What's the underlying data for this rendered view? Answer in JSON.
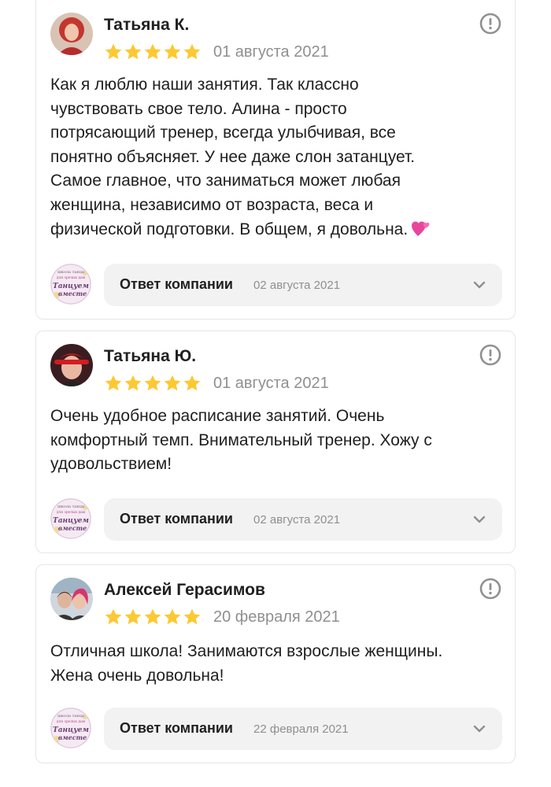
{
  "reviews": [
    {
      "author": "Татьяна К.",
      "rating": 5,
      "date": "01 августа 2021",
      "text_lines": [
        "Как я люблю наши занятия. Так классно",
        "чувствовать свое тело. Алина - просто",
        "потрясающий тренер, всегда улыбчивая, все",
        "понятно объясняет. У нее даже слон затанцует.",
        "Самое главное, что заниматься может любая",
        "женщина, независимо от возраста, веса и",
        "физической подготовки. В общем, я довольна."
      ],
      "emoji_icon": "two-hearts-icon",
      "reply_label": "Ответ компании",
      "reply_date": "02 августа 2021"
    },
    {
      "author": "Татьяна Ю.",
      "rating": 5,
      "date": "01 августа 2021",
      "text_lines": [
        "Очень удобное расписание занятий. Очень",
        "комфортный темп. Внимательный тренер. Хожу с",
        "удовольствием!"
      ],
      "reply_label": "Ответ компании",
      "reply_date": "02 августа 2021"
    },
    {
      "author": "Алексей Герасимов",
      "rating": 5,
      "date": "20 февраля 2021",
      "text_lines": [
        "Отличная школа! Занимаются взрослые женщины.",
        "Жена очень довольна!"
      ],
      "reply_label": "Ответ компании",
      "reply_date": "22 февраля 2021"
    }
  ],
  "company_logo": {
    "line1": "школа танца",
    "line2": "для зрелых дам",
    "line3": "Танцуем",
    "line4": "вместе"
  },
  "colors": {
    "star": "#fcc933",
    "muted_text": "#8f8f8f",
    "reply_bg": "#f2f2f2",
    "border": "#e6e6e6",
    "flag_icon": "#909090"
  },
  "icons": {
    "flag": "exclamation-circle-icon",
    "chevron": "chevron-down-icon",
    "star": "star-icon"
  }
}
